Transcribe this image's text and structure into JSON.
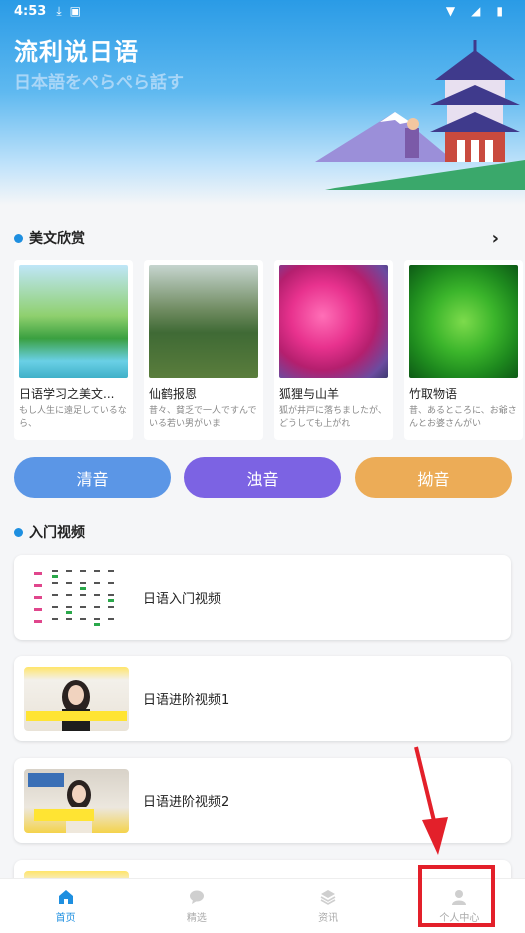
{
  "status_bar": {
    "time": "4:53"
  },
  "header": {
    "title": "流利说日语",
    "subtitle": "日本語をぺらぺら話す"
  },
  "articles_section": {
    "title": "美文欣赏",
    "items": [
      {
        "title": "日语学习之美文...",
        "desc": "もし人生に遠足しているなら、"
      },
      {
        "title": "仙鹤报恩",
        "desc": "昔々、貧乏で一人ですんでいる若い男がいま"
      },
      {
        "title": "狐狸与山羊",
        "desc": "狐が井戸に落ちましたが、どうしても上がれ"
      },
      {
        "title": "竹取物语",
        "desc": "昔、あるところに、お爺さんとお婆さんがい"
      }
    ]
  },
  "kana_buttons": {
    "seion": "清音",
    "dakuon": "浊音",
    "youon": "拗音"
  },
  "video_section": {
    "title": "入门视频",
    "items": [
      {
        "title": "日语入门视频"
      },
      {
        "title": "日语进阶视频1"
      },
      {
        "title": "日语进阶视频2"
      }
    ]
  },
  "tab_bar": {
    "tabs": [
      {
        "label": "首页",
        "icon": "home-icon"
      },
      {
        "label": "精选",
        "icon": "chat-icon"
      },
      {
        "label": "资讯",
        "icon": "layers-icon"
      },
      {
        "label": "个人中心",
        "icon": "person-icon"
      }
    ]
  },
  "colors": {
    "accent": "#1e8fe0",
    "seion": "#5b96e6",
    "dakuon": "#7c63e3",
    "youon": "#ecac57",
    "annotation": "#e3202a"
  }
}
